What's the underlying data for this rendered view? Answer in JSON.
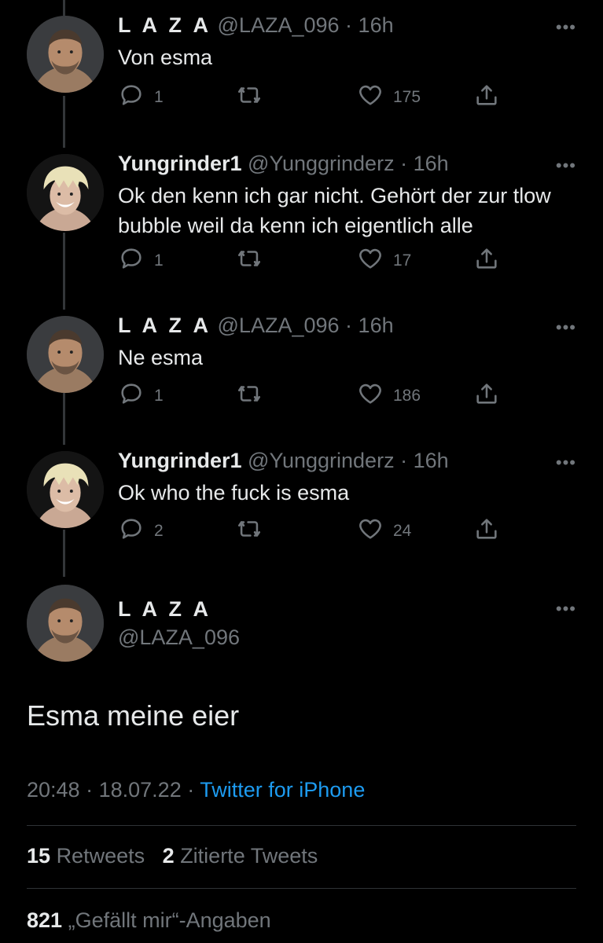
{
  "thread": [
    {
      "name": "L A Z A",
      "handle": "@LAZA_096",
      "time": "16h",
      "text": "Von esma",
      "replies": "1",
      "retweets": "",
      "likes": "175",
      "avatar": "laza"
    },
    {
      "name": "Yungrinder1",
      "handle": "@Yunggrinderz",
      "time": "16h",
      "text": "Ok den kenn ich gar nicht. Gehört der zur tlow bubble weil da kenn ich eigentlich alle",
      "replies": "1",
      "retweets": "",
      "likes": "17",
      "avatar": "yung"
    },
    {
      "name": "L A Z A",
      "handle": "@LAZA_096",
      "time": "16h",
      "text": "Ne esma",
      "replies": "1",
      "retweets": "",
      "likes": "186",
      "avatar": "laza"
    },
    {
      "name": "Yungrinder1",
      "handle": "@Yunggrinderz",
      "time": "16h",
      "text": "Ok who the fuck is esma",
      "replies": "2",
      "retweets": "",
      "likes": "24",
      "avatar": "yung"
    }
  ],
  "main": {
    "name": "L A Z A",
    "handle": "@LAZA_096",
    "text": "Esma meine eier",
    "time": "20:48",
    "date": "18.07.22",
    "source": "Twitter for iPhone",
    "retweets_count": "15",
    "retweets_label": "Retweets",
    "quotes_count": "2",
    "quotes_label": "Zitierte Tweets",
    "likes_count": "821",
    "likes_label": "„Gefällt mir“-Angaben"
  },
  "separator": "·",
  "more_glyph": "•••",
  "colors": {
    "background": "#000000",
    "text": "#e7e9ea",
    "secondary": "#71767b",
    "link": "#1d9bf0",
    "divider": "#2f3336"
  },
  "icons": [
    "reply-icon",
    "retweet-icon",
    "like-icon",
    "share-icon",
    "more-icon"
  ]
}
